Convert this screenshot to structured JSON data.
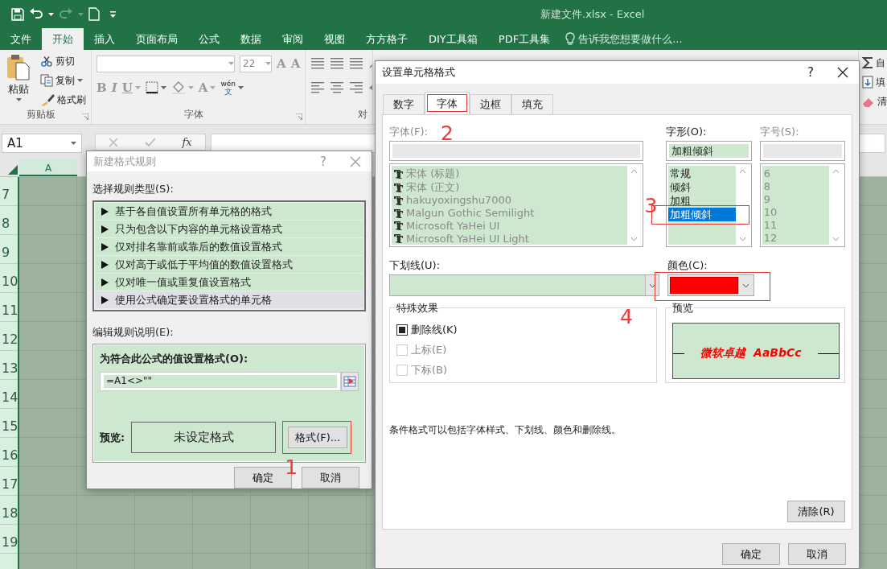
{
  "title_bar": {
    "title": "新建文件.xlsx - Excel"
  },
  "ribbon_tabs": [
    {
      "label": "文件",
      "selected": false
    },
    {
      "label": "开始",
      "selected": true
    },
    {
      "label": "插入",
      "selected": false
    },
    {
      "label": "页面布局",
      "selected": false
    },
    {
      "label": "公式",
      "selected": false
    },
    {
      "label": "数据",
      "selected": false
    },
    {
      "label": "审阅",
      "selected": false
    },
    {
      "label": "视图",
      "selected": false
    },
    {
      "label": "方方格子",
      "selected": false
    },
    {
      "label": "DIY工具箱",
      "selected": false
    },
    {
      "label": "PDF工具集",
      "selected": false
    }
  ],
  "tell_me": {
    "placeholder": "告诉我您想要做什么..."
  },
  "ribbon": {
    "clipboard": {
      "paste": "粘贴",
      "cut": "剪切",
      "copy": "复制",
      "format_painter": "格式刷",
      "label": "剪贴板"
    },
    "font": {
      "font_size": "22",
      "grow": "A",
      "shrink": "A",
      "bold": "B",
      "italic": "I",
      "underline": "U",
      "font_color": "A",
      "phonetic_top": "wén",
      "phonetic_bottom": "文",
      "label": "字体"
    },
    "alignment": {
      "label": "对"
    },
    "editing": [
      {
        "kind": "sum",
        "label": "自"
      },
      {
        "kind": "fill",
        "label": "填"
      },
      {
        "kind": "clear",
        "label": "清"
      }
    ]
  },
  "formula_bar": {
    "name_box": "A1",
    "function_button": "fx"
  },
  "sheet": {
    "columns": [
      "A"
    ],
    "rows": [
      "7",
      "8",
      "9",
      "10",
      "11",
      "12",
      "13",
      "14",
      "15",
      "16",
      "17",
      "18",
      "19"
    ]
  },
  "rule_dialog": {
    "title": "新建格式规则",
    "active": false,
    "help": "?",
    "rule_type_label": "选择规则类型(S):",
    "rule_types": [
      {
        "label": "基于各自值设置所有单元格的格式",
        "selected": false
      },
      {
        "label": "只为包含以下内容的单元格设置格式",
        "selected": false
      },
      {
        "label": "仅对排名靠前或靠后的数值设置格式",
        "selected": false
      },
      {
        "label": "仅对高于或低于平均值的数值设置格式",
        "selected": false
      },
      {
        "label": "仅对唯一值或重复值设置格式",
        "selected": false
      },
      {
        "label": "使用公式确定要设置格式的单元格",
        "selected": true
      }
    ],
    "description_label": "编辑规则说明(E):",
    "formula_label": "为符合此公式的值设置格式(O):",
    "formula": "=A1<>\"\"",
    "preview_label": "预览:",
    "preview_text": "未设定格式",
    "format_button": {
      "label": "格式(F)...",
      "highlighted": true,
      "callout": "1"
    },
    "buttons": [
      "确定",
      "取消"
    ]
  },
  "format_dialog": {
    "title": "设置单元格格式",
    "active": true,
    "help": "?",
    "tabs": [
      {
        "label": "数字",
        "selected": false,
        "highlighted": false
      },
      {
        "label": "字体",
        "selected": true,
        "highlighted": true
      },
      {
        "label": "边框",
        "selected": false,
        "highlighted": false
      },
      {
        "label": "填充",
        "selected": false,
        "highlighted": false
      }
    ],
    "font": {
      "label": "字体(F):",
      "disabled": true,
      "callout": "2",
      "items": [
        {
          "label": "宋体 (标题)"
        },
        {
          "label": "宋体 (正文)"
        },
        {
          "label": "hakuyoxingshu7000"
        },
        {
          "label": "Malgun Gothic Semilight"
        },
        {
          "label": "Microsoft YaHei UI"
        },
        {
          "label": "Microsoft YaHei UI Light"
        }
      ]
    },
    "style": {
      "label": "字形(O):",
      "disabled": false,
      "value": "加粗倾斜",
      "callout": "3",
      "highlighted": true,
      "items": [
        {
          "label": "常规",
          "selected": false
        },
        {
          "label": "倾斜",
          "selected": false
        },
        {
          "label": "加粗",
          "selected": false
        },
        {
          "label": "加粗倾斜",
          "selected": true
        }
      ]
    },
    "size": {
      "label": "字号(S):",
      "disabled": true,
      "items": [
        "6",
        "8",
        "9",
        "10",
        "11",
        "12"
      ]
    },
    "underline": {
      "label": "下划线(U):"
    },
    "color": {
      "label": "颜色(C):",
      "color": "#ff0000",
      "highlighted": true,
      "callout": "4"
    },
    "effects": {
      "title": "特殊效果",
      "options": [
        {
          "label": "删除线(K)",
          "checked": true,
          "disabled": false
        },
        {
          "label": "上标(E)",
          "checked": false,
          "disabled": true
        },
        {
          "label": "下标(B)",
          "checked": false,
          "disabled": true
        }
      ]
    },
    "preview": {
      "title": "预览",
      "sample": "微软卓越  AaBbCc"
    },
    "note": "条件格式可以包括字体样式、下划线、颜色和删除线。",
    "clear_button": "清除(R)",
    "buttons": [
      "确定",
      "取消"
    ]
  }
}
